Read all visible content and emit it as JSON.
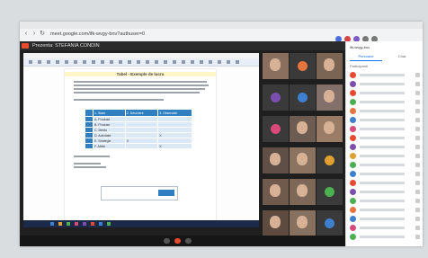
{
  "browser": {
    "url": "meet.google.com/ifk-wvgy-bnv?authuser=0",
    "extensions": [
      "blue",
      "red",
      "purple",
      "gray",
      "gray"
    ]
  },
  "meeting": {
    "presenter_label": "Prezenta: STEFANIA CONDIN",
    "document": {
      "title": "Tabel - Exemple de lucru",
      "table_headers": [
        "",
        "1. Stare",
        "2. Descriere",
        "3. Observatii"
      ],
      "table_rows": [
        [
          "A. Produse",
          "",
          ""
        ],
        [
          "B. Produse",
          "",
          ""
        ],
        [
          "C. Mediu",
          "",
          ""
        ],
        [
          "D. Activitate",
          "",
          "X"
        ],
        [
          "E. Strategie",
          "X",
          ""
        ],
        [
          "F. Altele",
          "",
          "X"
        ]
      ]
    },
    "tiles": [
      {
        "kind": "photo",
        "color": "#8a6f5e"
      },
      {
        "kind": "avatar",
        "color": "#e6743d"
      },
      {
        "kind": "photo",
        "color": "#7a6555"
      },
      {
        "kind": "avatar",
        "color": "#7b4fb0"
      },
      {
        "kind": "avatar",
        "color": "#3f7fd0"
      },
      {
        "kind": "photo",
        "color": "#84706a"
      },
      {
        "kind": "avatar",
        "color": "#d94a7a"
      },
      {
        "kind": "photo",
        "color": "#6d5c52"
      },
      {
        "kind": "photo",
        "color": "#9a7b66"
      },
      {
        "kind": "photo",
        "color": "#5f4f46"
      },
      {
        "kind": "photo",
        "color": "#8b735f"
      },
      {
        "kind": "avatar",
        "color": "#e0a030"
      },
      {
        "kind": "photo",
        "color": "#6f5a4c"
      },
      {
        "kind": "photo",
        "color": "#7d6757"
      },
      {
        "kind": "avatar",
        "color": "#4caf50"
      },
      {
        "kind": "photo",
        "color": "#5e4b40"
      },
      {
        "kind": "photo",
        "color": "#86705f"
      },
      {
        "kind": "avatar",
        "color": "#3f7fd0"
      }
    ]
  },
  "panel": {
    "title": "ifk-wvgy-bnv",
    "tabs": [
      "Persoane",
      "Chat"
    ],
    "section": "Participanti",
    "people": [
      {
        "color": "#e84a2f"
      },
      {
        "color": "#7b4fb0"
      },
      {
        "color": "#e84a2f"
      },
      {
        "color": "#4caf50"
      },
      {
        "color": "#e6743d"
      },
      {
        "color": "#3f7fd0"
      },
      {
        "color": "#d94a7a"
      },
      {
        "color": "#e84a2f"
      },
      {
        "color": "#7b4fb0"
      },
      {
        "color": "#e0a030"
      },
      {
        "color": "#4caf50"
      },
      {
        "color": "#3f7fd0"
      },
      {
        "color": "#e84a2f"
      },
      {
        "color": "#7b4fb0"
      },
      {
        "color": "#4caf50"
      },
      {
        "color": "#e6743d"
      },
      {
        "color": "#3f7fd0"
      },
      {
        "color": "#d94a7a"
      },
      {
        "color": "#4caf50"
      }
    ]
  },
  "colors": {
    "meet_bg": "#1f1f1f",
    "accent": "#1a73e8",
    "presenting": "#e84a2f",
    "table_header": "#2f7fc1"
  }
}
